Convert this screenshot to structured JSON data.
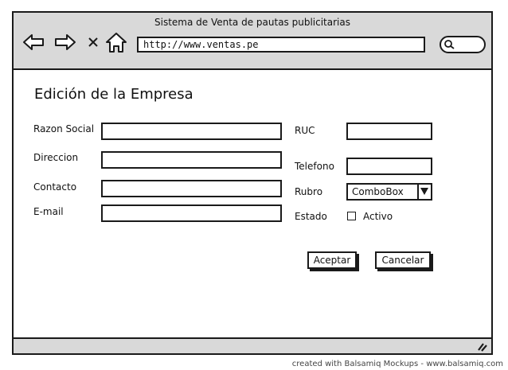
{
  "window": {
    "title": "Sistema de Venta de pautas publicitarias"
  },
  "browser": {
    "url": "http://www.ventas.pe"
  },
  "form": {
    "title": "Edición de la Empresa",
    "labels": {
      "razon_social": "Razon Social",
      "direccion": "Direccion",
      "contacto": "Contacto",
      "email": "E-mail",
      "ruc": "RUC",
      "telefono": "Telefono",
      "rubro": "Rubro",
      "estado": "Estado"
    },
    "values": {
      "razon_social": "",
      "direccion": "",
      "contacto": "",
      "email": "",
      "ruc": "",
      "telefono": ""
    },
    "rubro_selected": "ComboBox",
    "estado_checkbox_label": "Activo",
    "estado_checked": false,
    "buttons": {
      "accept": "Aceptar",
      "cancel": "Cancelar"
    }
  },
  "icons": [
    "back-arrow-icon",
    "forward-arrow-icon",
    "close-icon",
    "home-icon",
    "search-icon",
    "dropdown-arrow-icon",
    "resize-grip-icon"
  ],
  "footer": {
    "credit": "created with Balsamiq Mockups - www.balsamiq.com"
  }
}
